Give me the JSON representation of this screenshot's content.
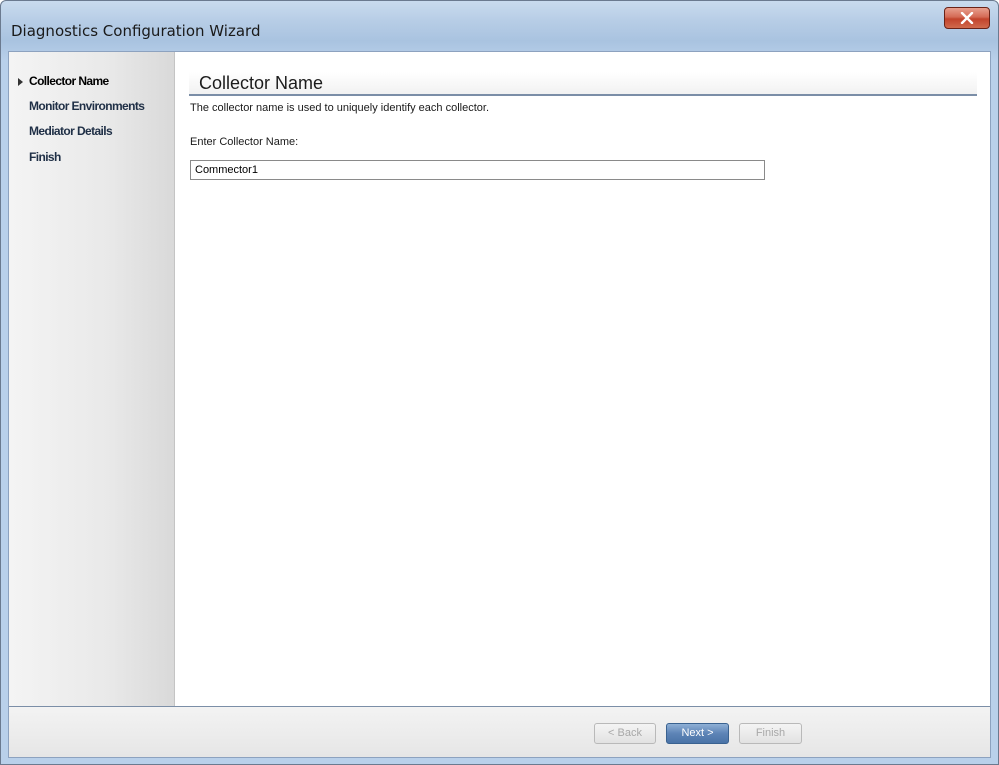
{
  "window": {
    "title": "Diagnostics Configuration Wizard",
    "close_icon": "close-x-icon"
  },
  "sidebar": {
    "steps": [
      {
        "label": "Collector Name",
        "active": true
      },
      {
        "label": "Monitor Environments",
        "active": false
      },
      {
        "label": "Mediator Details",
        "active": false
      },
      {
        "label": "Finish",
        "active": false
      }
    ],
    "current_marker_icon": "triangle-right-icon"
  },
  "main": {
    "title": "Collector Name",
    "description": "The collector name is used to uniquely identify each collector.",
    "field_label": "Enter Collector Name:",
    "collector_name_value": "Commector1"
  },
  "footer": {
    "back_label": "< Back",
    "next_label": "Next >",
    "finish_label": "Finish",
    "back_enabled": false,
    "next_enabled": true,
    "finish_enabled": false
  },
  "colors": {
    "close_button": "#c2432c",
    "primary_button": "#5d84b6",
    "title_rule": "#7b8ea7"
  }
}
